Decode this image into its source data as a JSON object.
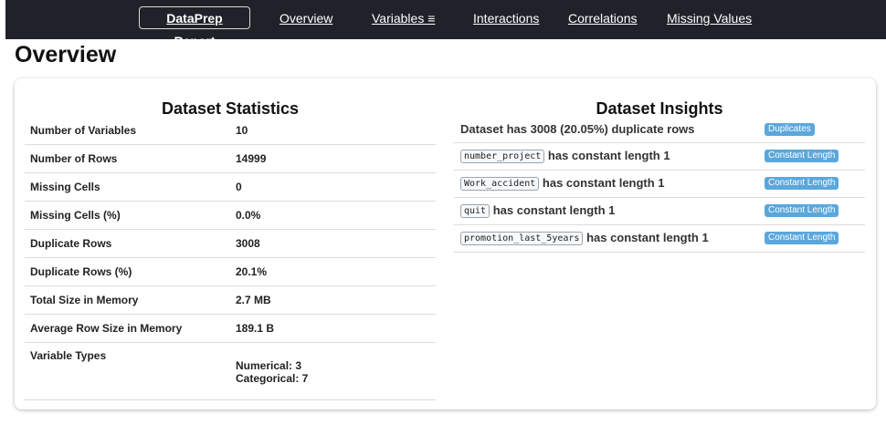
{
  "nav": {
    "brand": "DataPrep Report",
    "links": [
      "Overview",
      "Variables ≡",
      "Interactions",
      "Correlations",
      "Missing Values"
    ]
  },
  "page_title": "Overview",
  "stats": {
    "title": "Dataset Statistics",
    "rows": [
      {
        "label": "Number of Variables",
        "value": "10"
      },
      {
        "label": "Number of Rows",
        "value": "14999"
      },
      {
        "label": "Missing Cells",
        "value": "0"
      },
      {
        "label": "Missing Cells (%)",
        "value": "0.0%"
      },
      {
        "label": "Duplicate Rows",
        "value": "3008"
      },
      {
        "label": "Duplicate Rows (%)",
        "value": "20.1%"
      },
      {
        "label": "Total Size in Memory",
        "value": "2.7 MB"
      },
      {
        "label": "Average Row Size in Memory",
        "value": "189.1 B"
      }
    ],
    "types": {
      "label": "Variable Types",
      "numerical": "Numerical: 3",
      "categorical": "Categorical: 7"
    }
  },
  "insights": {
    "title": "Dataset Insights",
    "rows": [
      {
        "code": "",
        "text": "Dataset has 3008 (20.05%) duplicate rows",
        "badge": "Duplicates"
      },
      {
        "code": "number_project",
        "text": "has constant length 1",
        "badge": "Constant Length"
      },
      {
        "code": "Work_accident",
        "text": "has constant length 1",
        "badge": "Constant Length"
      },
      {
        "code": "quit",
        "text": "has constant length 1",
        "badge": "Constant Length"
      },
      {
        "code": "promotion_last_5years",
        "text": "has constant length 1",
        "badge": "Constant Length"
      }
    ]
  },
  "colors": {
    "navbar": "#1f2229",
    "badge": "#5aa7dc"
  }
}
